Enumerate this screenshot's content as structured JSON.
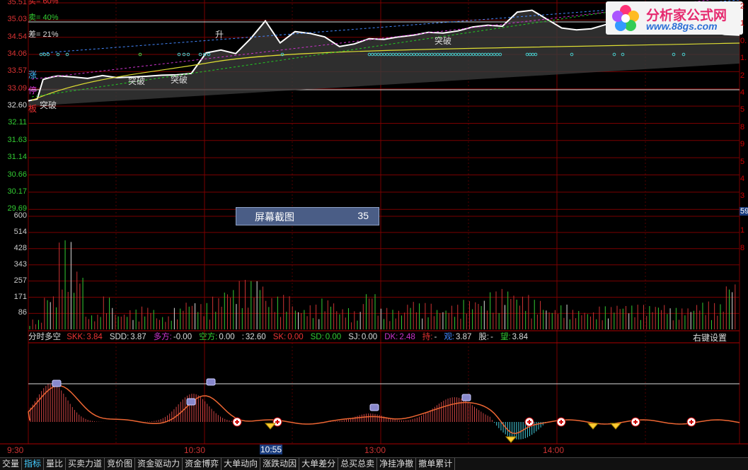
{
  "price_axis": {
    "labels": [
      "35.51",
      "35.03",
      "34.54",
      "34.06",
      "33.57",
      "33.09",
      "32.60",
      "32.11",
      "31.63",
      "31.14",
      "30.66",
      "30.17",
      "29.69"
    ],
    "colors": [
      "#d33",
      "#d33",
      "#d33",
      "#d33",
      "#d33",
      "#d33",
      "#ddd",
      "#3c3",
      "#3c3",
      "#3c3",
      "#3c3",
      "#3c3",
      "#3c3"
    ],
    "range": [
      29.45,
      35.75
    ],
    "prev_close": 32.6
  },
  "volume_axis": {
    "labels": [
      "600",
      "514",
      "428",
      "343",
      "257",
      "171",
      "86"
    ]
  },
  "right_axis_labels": [
    "2",
    "1",
    "0.",
    "1.",
    "2",
    "4",
    "5",
    "8",
    "9",
    "5",
    "4",
    "3",
    "2",
    "1",
    "8"
  ],
  "top_info": {
    "buy_label": "买= 60%",
    "sell_label": "卖= 40%",
    "diff_label": "差= 21%"
  },
  "side_labels": {
    "zhang": "涨",
    "ting": "停",
    "ban": "板"
  },
  "signals": {
    "breakthrough": "突破",
    "rise": "升"
  },
  "indicator_bar": {
    "name": "分时多空",
    "items": [
      {
        "label": "SKK:",
        "value": "3.84",
        "color": "#e33"
      },
      {
        "label": "SDD:",
        "value": "3.87",
        "color": "#ddd"
      },
      {
        "label": "多方:",
        "value": "-0.00",
        "color": "#c3c"
      },
      {
        "label": "空方:",
        "value": "0.00",
        "color": "#3c3"
      },
      {
        "label": ":",
        "value": "32.60",
        "color": "#ddd"
      },
      {
        "label": "SK:",
        "value": "0.00",
        "color": "#e33"
      },
      {
        "label": "SD:",
        "value": "0.00",
        "color": "#3c3"
      },
      {
        "label": "SJ:",
        "value": "0.00",
        "color": "#ddd"
      },
      {
        "label": "DK:",
        "value": "2.48",
        "color": "#c3c"
      },
      {
        "label": "持:",
        "value": "-",
        "color": "#e33"
      },
      {
        "label": "观:",
        "value": "3.87",
        "color": "#48f"
      },
      {
        "label": "股:",
        "value": "-",
        "color": "#ddd"
      },
      {
        "label": "望:",
        "value": "3.84",
        "color": "#3c3"
      }
    ],
    "settings_label": "右键设置"
  },
  "overlay": {
    "title": "屏幕截图",
    "count": "35"
  },
  "time_axis": {
    "labels": [
      "9:30",
      "10:30",
      "13:00",
      "14:00"
    ],
    "current": "10:55"
  },
  "tabs": [
    "交量",
    "指标",
    "量比",
    "买卖力道",
    "竞价图",
    "资金驱动力",
    "资金博弈",
    "大单动向",
    "涨跌动因",
    "大单差分",
    "总买总卖",
    "净挂净撤",
    "撤单累计"
  ],
  "active_tab": "指标",
  "logo": {
    "title": "分析家公式网",
    "url": "www.88gs.com"
  },
  "right_badge": "59",
  "chart_data": {
    "type": "line",
    "title": "",
    "series": [
      {
        "name": "",
        "x_minutes": [
          0,
          3,
          5,
          8,
          10,
          15,
          20,
          25,
          30,
          35,
          40,
          45,
          50,
          55,
          60,
          65,
          70,
          75,
          80,
          85,
          90,
          95,
          100,
          105,
          110,
          115,
          120,
          125,
          130,
          135,
          140,
          145,
          150,
          155,
          160,
          165,
          170,
          175,
          180,
          185,
          190,
          195,
          200,
          205,
          210,
          215,
          220,
          225,
          230,
          235,
          240
        ],
        "values": [
          32.75,
          32.8,
          33.35,
          33.42,
          33.45,
          33.42,
          33.38,
          33.46,
          33.4,
          33.42,
          33.44,
          33.47,
          33.48,
          33.52,
          34.1,
          34.18,
          34.08,
          34.5,
          35.0,
          34.38,
          34.7,
          34.65,
          34.55,
          34.28,
          34.35,
          34.5,
          34.48,
          34.55,
          34.6,
          34.68,
          34.66,
          34.72,
          34.83,
          34.88,
          34.85,
          35.25,
          35.3,
          35.05,
          34.8,
          34.75,
          34.78,
          34.9,
          34.88,
          34.7,
          34.73,
          34.7,
          34.65,
          34.68,
          34.7,
          34.62,
          34.6
        ]
      }
    ],
    "volume": [
      60,
      220,
      540,
      380,
      90,
      200,
      100,
      120,
      140,
      80,
      130,
      180,
      160,
      200,
      260,
      300,
      320,
      200,
      210,
      130,
      150,
      190,
      130,
      110,
      240,
      130,
      120,
      180,
      160,
      130,
      150,
      180,
      190,
      230,
      250,
      210,
      180,
      130,
      150,
      120,
      110,
      140,
      160,
      150,
      150,
      160,
      130,
      140,
      170,
      160,
      300
    ],
    "ylim": [
      29.45,
      35.75
    ],
    "volume_ylim": [
      0,
      650
    ]
  }
}
